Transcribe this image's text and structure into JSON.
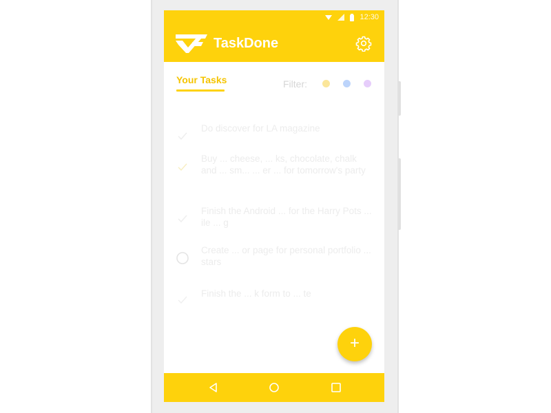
{
  "status_bar": {
    "time": "12:30"
  },
  "app_bar": {
    "title": "TaskDone"
  },
  "tabs": {
    "active_label": "Your Tasks"
  },
  "filter": {
    "label": "Filter:",
    "colors": [
      "#fbe69a",
      "#bcd4fb",
      "#e6cdfb"
    ]
  },
  "tasks": [
    {
      "text": "Do discover for LA magazine"
    },
    {
      "text": "Buy ... cheese, ... ks, chocolate, chalk and ... sm... ... er ... for tomorrow's party"
    },
    {
      "text": "Finish the Android ... for the Harry Pots ... ile ... g"
    },
    {
      "text": "Create ... or page for personal portfolio ... stars"
    },
    {
      "text": "Finish the ... k form to ... te"
    }
  ],
  "fab": {
    "label": "+"
  },
  "colors": {
    "accent": "#fed20c",
    "tab_text": "#f5c400",
    "background": "#ffffff"
  }
}
